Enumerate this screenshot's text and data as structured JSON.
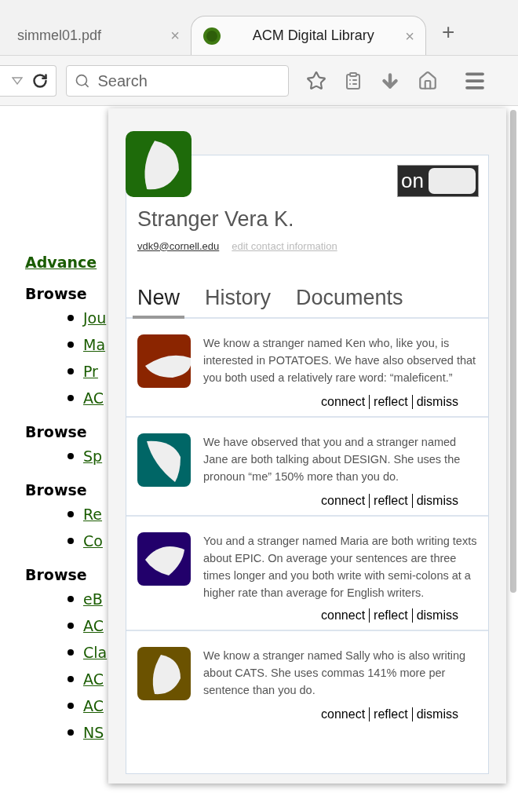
{
  "tabs": [
    {
      "label": "simmel01.pdf",
      "close": "×",
      "selected": false
    },
    {
      "label": "ACM Digital Library",
      "close": "×",
      "selected": true
    }
  ],
  "new_tab": "+",
  "search": {
    "placeholder": "Search"
  },
  "page": {
    "link": "Advance",
    "sections": [
      {
        "heading": "Browse",
        "links": [
          "Jou",
          "Ma",
          "Pr",
          "AC"
        ]
      },
      {
        "heading": "Browse",
        "links": [
          "Sp"
        ]
      },
      {
        "heading": "Browse",
        "links": [
          "Re",
          "Co"
        ]
      },
      {
        "heading": "Browse",
        "links": [
          "eB",
          "AC",
          "Cla",
          "AC",
          "AC",
          "NS"
        ]
      }
    ]
  },
  "popup": {
    "toggle": {
      "label": "on",
      "on": true
    },
    "name": "Stranger Vera K.",
    "email": "vdk9@cornell.edu",
    "edit_link": "edit contact information",
    "tabs": [
      {
        "label": "New",
        "selected": true
      },
      {
        "label": "History",
        "selected": false
      },
      {
        "label": "Documents",
        "selected": false
      }
    ],
    "items": [
      {
        "color": "#8b2500",
        "text": "We know a stranger named Ken who, like you, is interested in POTATOES. We have also observed that you both used a relatively rare word: “maleficent.”",
        "actions": [
          "connect",
          "reflect",
          "dismiss"
        ]
      },
      {
        "color": "#006666",
        "text": "We have observed that you and a stranger named Jane are both talking about DESIGN. She uses the pronoun “me” 150% more than you do.",
        "actions": [
          "connect",
          "reflect",
          "dismiss"
        ]
      },
      {
        "color": "#22006b",
        "text": "You and a stranger named Maria are both writing texts about EPIC. On average your sentences are three times longer and you both write with semi-colons at a higher rate than average for English writers.",
        "actions": [
          "connect",
          "reflect",
          "dismiss"
        ]
      },
      {
        "color": "#6b5200",
        "text": "We know a stranger named Sally who is also writing about CATS. She uses commas 141% more per sentence than you do.",
        "actions": [
          "connect",
          "reflect",
          "dismiss"
        ]
      }
    ]
  }
}
